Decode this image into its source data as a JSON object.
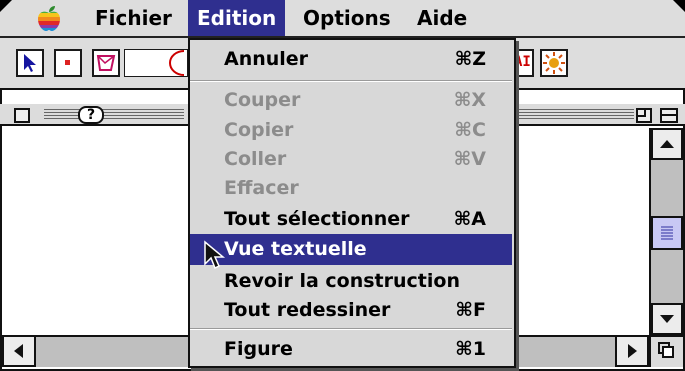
{
  "menubar": {
    "apple": "apple-icon",
    "menus": [
      "Fichier",
      "Edition",
      "Options",
      "Aide"
    ],
    "active_menu": "Edition"
  },
  "toolbar": {
    "tools": [
      "arrow-tool-icon",
      "point-tool-icon",
      "polygon-tool-icon",
      "circle-tool-icon",
      "text-tool-icon",
      "animation-tool-icon"
    ],
    "text_tool_glyph": "AI"
  },
  "window": {
    "help_glyph": "?"
  },
  "edit_menu": {
    "items": [
      {
        "label": "Annuler",
        "shortcut": "⌘Z",
        "enabled": true
      },
      {
        "label": "Couper",
        "shortcut": "⌘X",
        "enabled": false
      },
      {
        "label": "Copier",
        "shortcut": "⌘C",
        "enabled": false
      },
      {
        "label": "Coller",
        "shortcut": "⌘V",
        "enabled": false
      },
      {
        "label": "Effacer",
        "shortcut": "",
        "enabled": false
      },
      {
        "label": "Tout sélectionner",
        "shortcut": "⌘A",
        "enabled": true
      },
      {
        "label": "Vue textuelle",
        "shortcut": "",
        "enabled": true,
        "highlighted": true
      },
      {
        "label": "Revoir la construction",
        "shortcut": "",
        "enabled": true
      },
      {
        "label": "Tout redessiner",
        "shortcut": "⌘F",
        "enabled": true
      },
      {
        "label": "Figure",
        "shortcut": "⌘1",
        "enabled": true
      }
    ]
  },
  "colors": {
    "highlight": "#2f2f8f",
    "scroll_thumb": "#c8c8f4",
    "disabled_text": "#8c8c8c"
  }
}
